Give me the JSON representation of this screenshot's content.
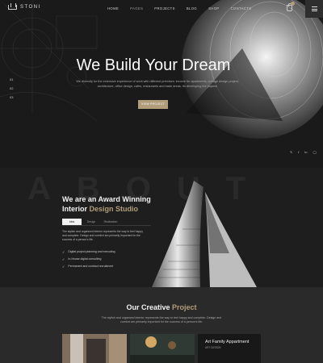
{
  "header": {
    "logo": "STONI",
    "nav": [
      "HOME",
      "PAGES",
      "PROJECTS",
      "BLOG",
      "SHOP",
      "CONTACTS"
    ]
  },
  "hero": {
    "title": "We Build Your Dream",
    "subtitle": "We diversify for the extensive experience of work with different premises: income for apartments, cottage design project, architecture, office design, cafes, restaurants and trade areas. Its developing the papers!",
    "button": "VIEW PROJECT",
    "slides": [
      "01",
      "02",
      "03"
    ],
    "socials": [
      "twitter-icon",
      "facebook-icon",
      "linkedin-icon",
      "instagram-icon"
    ]
  },
  "about": {
    "watermark": "ABOUT",
    "title_line1": "We are an Award Winning",
    "title_line2_plain": "Interior ",
    "title_line2_accent": "Design Studio",
    "tabs": [
      "Idea",
      "Design",
      "Realization"
    ],
    "body": "The stylish and organized interior represents the way to feel happy and complete. Design and comfort are primarily important for the success of a person's life.",
    "checks": [
      "Digital project planning and executing",
      "In-House digital consulting",
      "Permanent and contract recruitment"
    ]
  },
  "projects": {
    "title_plain": "Our Creative ",
    "title_accent": "Project",
    "subtitle": "The stylish and organized interior represents the way to feel happy and complete. Design and comfort are primarily important for the success of a person's life.",
    "card3_title": "Art Family Appartment",
    "card3_category": "ART DESIGN"
  },
  "colors": {
    "accent": "#b29d7a",
    "bg": "#1c1c1c"
  }
}
